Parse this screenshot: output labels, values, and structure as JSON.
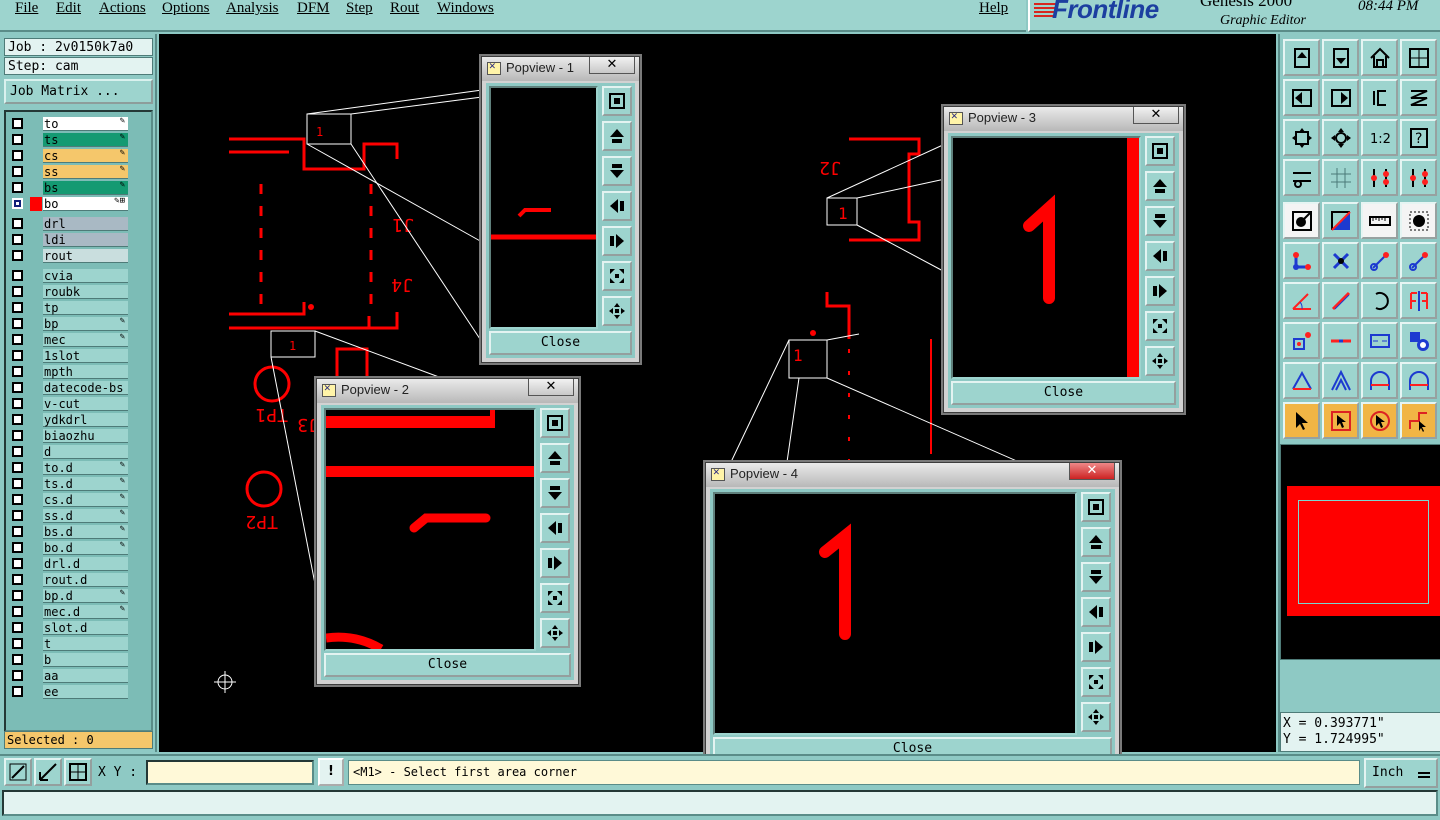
{
  "menu": [
    "File",
    "Edit",
    "Actions",
    "Options",
    "Analysis",
    "DFM",
    "Step",
    "Rout",
    "Windows"
  ],
  "help": "Help",
  "brand": {
    "logo": "Frontline",
    "product": "Genesis 2000",
    "subtitle": "Graphic Editor",
    "clock": "08:44 PM"
  },
  "job": {
    "job_line": "Job : 2v0150k7a0",
    "step_line": "Step: cam",
    "matrix_button": "Job Matrix ..."
  },
  "layers": [
    {
      "name": "to",
      "swatch": "",
      "bg": "#ffffff",
      "mark": "✎",
      "checked": false
    },
    {
      "name": "ts",
      "swatch": "",
      "bg": "#149a72",
      "mark": "✎",
      "checked": false
    },
    {
      "name": "cs",
      "swatch": "",
      "bg": "#f5c76b",
      "mark": "✎",
      "checked": false
    },
    {
      "name": "ss",
      "swatch": "",
      "bg": "#f5c76b",
      "mark": "✎",
      "checked": false
    },
    {
      "name": "bs",
      "swatch": "",
      "bg": "#149a72",
      "mark": "✎",
      "checked": false
    },
    {
      "name": "bo",
      "swatch": "#ff0000",
      "bg": "#ffffff",
      "mark": "✎⊞",
      "checked": true
    },
    {
      "name": "drl",
      "swatch": "",
      "bg": "#a9b9c4",
      "mark": "",
      "checked": false,
      "gap": true
    },
    {
      "name": "ldi",
      "swatch": "",
      "bg": "#a9b9c4",
      "mark": "",
      "checked": false
    },
    {
      "name": "rout",
      "swatch": "",
      "bg": "#c9dede",
      "mark": "",
      "checked": false
    },
    {
      "name": "cvia",
      "swatch": "",
      "bg": "#9dd4ce",
      "mark": "",
      "checked": false,
      "gap": true
    },
    {
      "name": "roubk",
      "swatch": "",
      "bg": "#9dd4ce",
      "mark": "",
      "checked": false
    },
    {
      "name": "tp",
      "swatch": "",
      "bg": "#9dd4ce",
      "mark": "",
      "checked": false
    },
    {
      "name": "bp",
      "swatch": "",
      "bg": "#9dd4ce",
      "mark": "✎",
      "checked": false
    },
    {
      "name": "mec",
      "swatch": "",
      "bg": "#9dd4ce",
      "mark": "✎",
      "checked": false
    },
    {
      "name": "1slot",
      "swatch": "",
      "bg": "#9dd4ce",
      "mark": "",
      "checked": false
    },
    {
      "name": "mpth",
      "swatch": "",
      "bg": "#9dd4ce",
      "mark": "",
      "checked": false
    },
    {
      "name": "datecode-bs",
      "swatch": "",
      "bg": "#9dd4ce",
      "mark": "",
      "checked": false
    },
    {
      "name": "v-cut",
      "swatch": "",
      "bg": "#9dd4ce",
      "mark": "",
      "checked": false
    },
    {
      "name": "ydkdrl",
      "swatch": "",
      "bg": "#9dd4ce",
      "mark": "",
      "checked": false
    },
    {
      "name": "biaozhu",
      "swatch": "",
      "bg": "#9dd4ce",
      "mark": "",
      "checked": false
    },
    {
      "name": "d",
      "swatch": "",
      "bg": "#9dd4ce",
      "mark": "",
      "checked": false
    },
    {
      "name": "to.d",
      "swatch": "",
      "bg": "#9dd4ce",
      "mark": "✎",
      "checked": false
    },
    {
      "name": "ts.d",
      "swatch": "",
      "bg": "#9dd4ce",
      "mark": "✎",
      "checked": false
    },
    {
      "name": "cs.d",
      "swatch": "",
      "bg": "#9dd4ce",
      "mark": "✎",
      "checked": false
    },
    {
      "name": "ss.d",
      "swatch": "",
      "bg": "#9dd4ce",
      "mark": "✎",
      "checked": false
    },
    {
      "name": "bs.d",
      "swatch": "",
      "bg": "#9dd4ce",
      "mark": "✎",
      "checked": false
    },
    {
      "name": "bo.d",
      "swatch": "",
      "bg": "#9dd4ce",
      "mark": "✎",
      "checked": false
    },
    {
      "name": "drl.d",
      "swatch": "",
      "bg": "#9dd4ce",
      "mark": "",
      "checked": false
    },
    {
      "name": "rout.d",
      "swatch": "",
      "bg": "#9dd4ce",
      "mark": "",
      "checked": false
    },
    {
      "name": "bp.d",
      "swatch": "",
      "bg": "#9dd4ce",
      "mark": "✎",
      "checked": false
    },
    {
      "name": "mec.d",
      "swatch": "",
      "bg": "#9dd4ce",
      "mark": "✎",
      "checked": false
    },
    {
      "name": "slot.d",
      "swatch": "",
      "bg": "#9dd4ce",
      "mark": "",
      "checked": false
    },
    {
      "name": "t",
      "swatch": "",
      "bg": "#9dd4ce",
      "mark": "",
      "checked": false
    },
    {
      "name": "b",
      "swatch": "",
      "bg": "#9dd4ce",
      "mark": "",
      "checked": false
    },
    {
      "name": "aa",
      "swatch": "",
      "bg": "#9dd4ce",
      "mark": "",
      "checked": false
    },
    {
      "name": "ee",
      "swatch": "",
      "bg": "#9dd4ce",
      "mark": "",
      "checked": false
    }
  ],
  "selected": "Selected : 0",
  "canvas_labels": {
    "j2": "J2",
    "j1": "J1",
    "j4": "J4",
    "tp1": "TP1",
    "tp2": "TP2",
    "j3": "J3",
    "one": "1"
  },
  "popviews": [
    {
      "title": "Popview - 1",
      "close": "Close",
      "glyph": "1"
    },
    {
      "title": "Popview - 2",
      "close": "Close",
      "glyph": "1"
    },
    {
      "title": "Popview - 3",
      "close": "Close",
      "glyph": "1"
    },
    {
      "title": "Popview - 4",
      "close": "Close",
      "glyph": "1"
    }
  ],
  "xbtn": "✕",
  "toolbar_icons": [
    "layer-up-icon",
    "layer-down-icon",
    "home-icon",
    "window-icon",
    "pan-left-icon",
    "pan-right-icon",
    "undo-view-icon",
    "redraw-icon",
    "zoom-fit-icon",
    "zoom-center-icon",
    "scale-1-2-icon",
    "help-icon",
    "settings-icon",
    "grid-icon",
    "snap-icon",
    "snap-alt-icon",
    "select-icon",
    "measure-icon",
    "ruler-icon",
    "pad-icon",
    "connect-icon",
    "cross-icon",
    "route-icon",
    "route-alt-icon",
    "angle-icon",
    "line-icon",
    "arc-icon",
    "split-icon",
    "move-point-icon",
    "segment-icon",
    "stretch-icon",
    "group-icon",
    "triangle-icon",
    "peak-icon",
    "arch-icon",
    "arch-alt-icon",
    "pointer-icon",
    "pointer-box-icon",
    "pointer-circle-icon",
    "pointer-route-icon"
  ],
  "scale_label": "1:2",
  "coords": {
    "x": "X = 0.393771\"",
    "y": "Y = 1.724995\""
  },
  "xy_label": "X Y :",
  "xy_value": "",
  "bang": "!",
  "prompt": "<M1> - Select first area corner",
  "unit": "Inch"
}
